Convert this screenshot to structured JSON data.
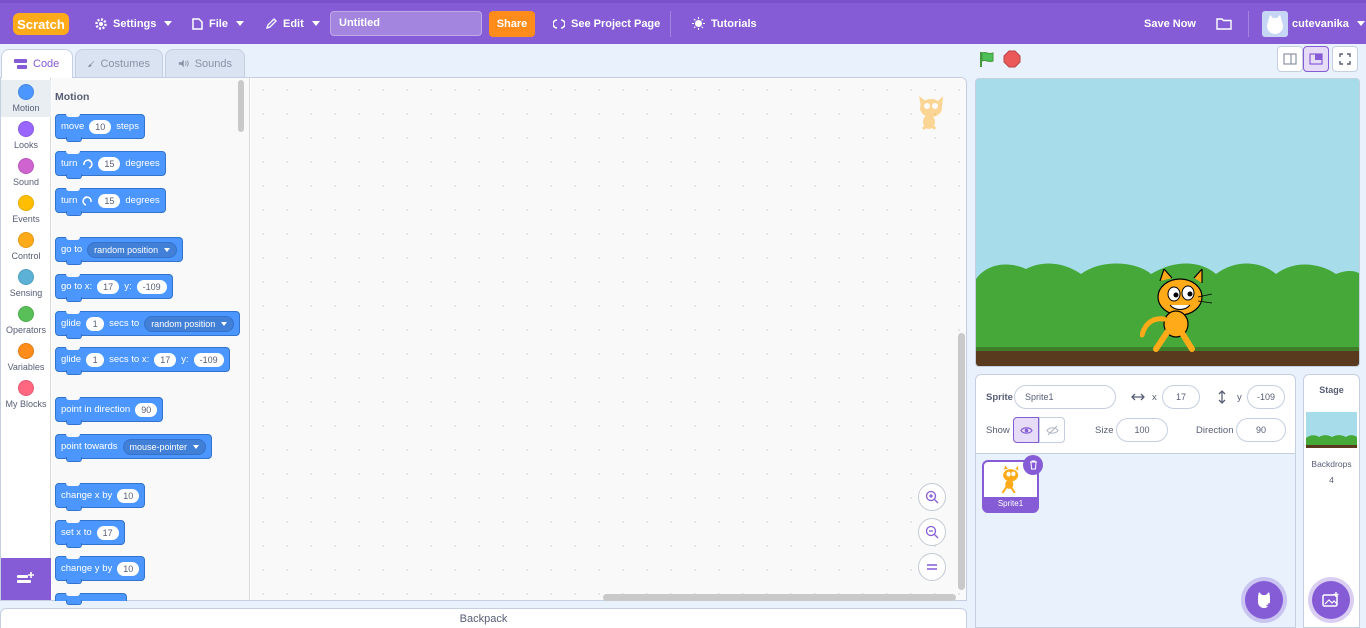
{
  "menu": {
    "logo": "Scratch",
    "settings": "Settings",
    "file": "File",
    "edit": "Edit",
    "project_title": "Untitled",
    "share": "Share",
    "see_project_page": "See Project Page",
    "tutorials": "Tutorials",
    "save_now": "Save Now",
    "username": "cutevanika"
  },
  "tabs": {
    "code": "Code",
    "costumes": "Costumes",
    "sounds": "Sounds"
  },
  "categories": [
    {
      "label": "Motion",
      "color": "#4c97ff"
    },
    {
      "label": "Looks",
      "color": "#9966ff"
    },
    {
      "label": "Sound",
      "color": "#cf63cf"
    },
    {
      "label": "Events",
      "color": "#ffbf00"
    },
    {
      "label": "Control",
      "color": "#ffab19"
    },
    {
      "label": "Sensing",
      "color": "#5cb1d6"
    },
    {
      "label": "Operators",
      "color": "#59c059"
    },
    {
      "label": "Variables",
      "color": "#ff8c1a"
    },
    {
      "label": "My Blocks",
      "color": "#ff6680"
    }
  ],
  "palette": {
    "heading": "Motion",
    "move": {
      "a": "move",
      "v": "10",
      "b": "steps"
    },
    "turn_right": {
      "a": "turn",
      "v": "15",
      "b": "degrees"
    },
    "turn_left": {
      "a": "turn",
      "v": "15",
      "b": "degrees"
    },
    "go_to": {
      "a": "go to",
      "d": "random position"
    },
    "go_to_xy": {
      "a": "go to x:",
      "x": "17",
      "b": "y:",
      "y": "-109"
    },
    "glide_to": {
      "a": "glide",
      "v": "1",
      "b": "secs to",
      "d": "random position"
    },
    "glide_xy": {
      "a": "glide",
      "v": "1",
      "b": "secs to x:",
      "x": "17",
      "c": "y:",
      "y": "-109"
    },
    "point_dir": {
      "a": "point in direction",
      "v": "90"
    },
    "point_towards": {
      "a": "point towards",
      "d": "mouse-pointer"
    },
    "change_x": {
      "a": "change x by",
      "v": "10"
    },
    "set_x": {
      "a": "set x to",
      "v": "17"
    },
    "change_y": {
      "a": "change y by",
      "v": "10"
    }
  },
  "backpack": "Backpack",
  "sprite_info": {
    "sprite_label": "Sprite",
    "sprite_name": "Sprite1",
    "x_label": "x",
    "x": "17",
    "y_label": "y",
    "y": "-109",
    "show_label": "Show",
    "size_label": "Size",
    "size": "100",
    "direction_label": "Direction",
    "direction": "90"
  },
  "sprite_list": [
    {
      "name": "Sprite1"
    }
  ],
  "stage_panel": {
    "title": "Stage",
    "backdrops_label": "Backdrops",
    "backdrops_count": "4"
  }
}
